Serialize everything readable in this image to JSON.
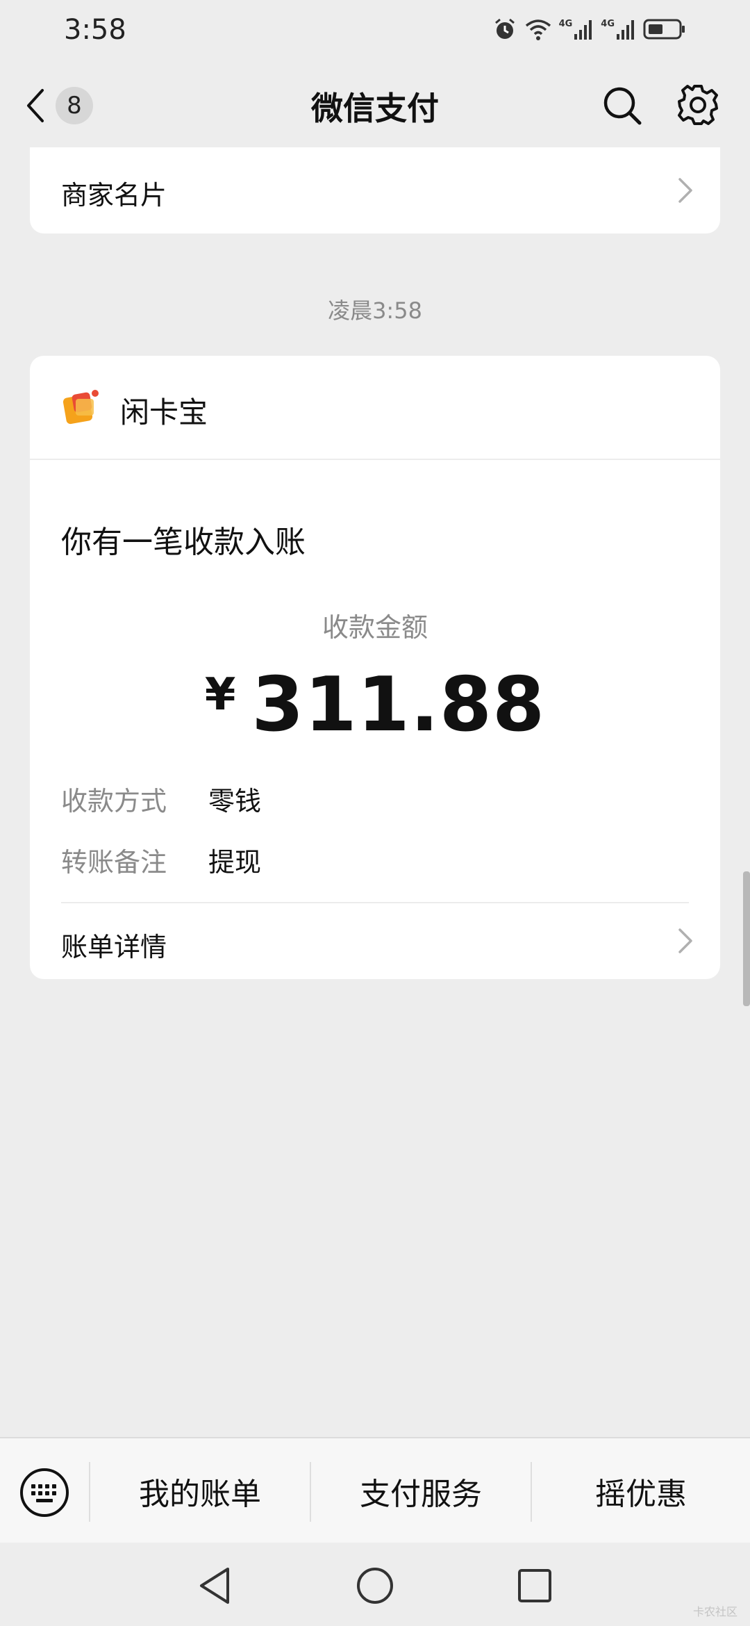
{
  "status_bar": {
    "time": "3:58",
    "icons": [
      "alarm-icon",
      "wifi-icon",
      "signal-4g-icon",
      "signal-4g-icon",
      "battery-icon"
    ],
    "network_label_1": "4G",
    "network_label_2": "4G"
  },
  "header": {
    "title": "微信支付",
    "unread_count": "8"
  },
  "merchant_row": {
    "label": "商家名片"
  },
  "timestamp": "凌晨3:58",
  "payment_card": {
    "brand_name": "闲卡宝",
    "notice_title": "你有一笔收款入账",
    "amount_label": "收款金额",
    "currency": "¥",
    "amount": "311.88",
    "details": [
      {
        "key": "收款方式",
        "value": "零钱"
      },
      {
        "key": "转账备注",
        "value": "提现"
      }
    ],
    "bill_details_label": "账单详情"
  },
  "menu_bar": {
    "items": [
      "我的账单",
      "支付服务",
      "摇优惠"
    ]
  },
  "watermark": "卡农社区",
  "colors": {
    "background": "#ededed",
    "card": "#ffffff",
    "secondary_text": "#8a8a8a",
    "logo_orange": "#f5a21b",
    "logo_red": "#e94b35"
  }
}
